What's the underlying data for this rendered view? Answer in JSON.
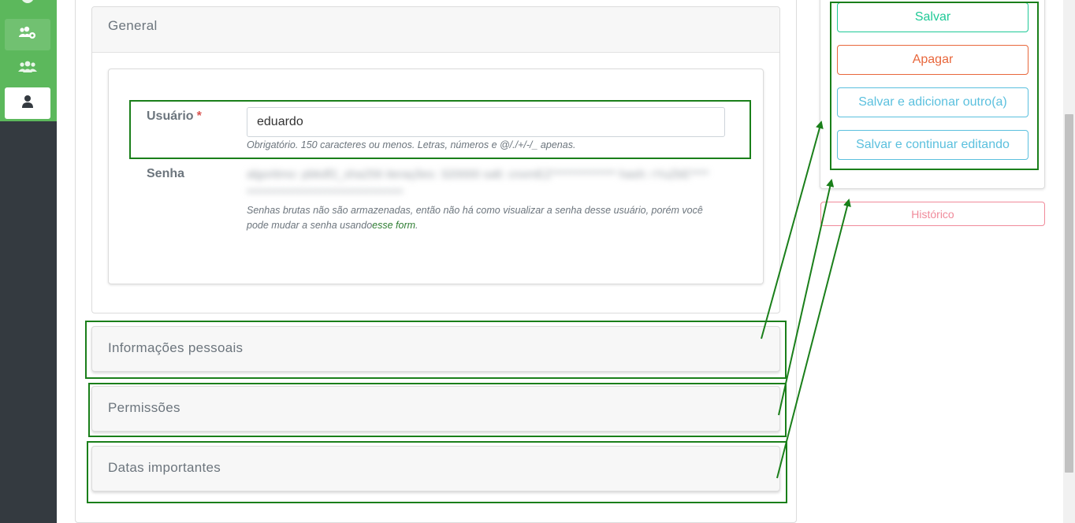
{
  "sidebar": {
    "items": [
      {
        "icon": "compass-icon"
      },
      {
        "icon": "users-cog-icon"
      },
      {
        "icon": "users-icon"
      },
      {
        "icon": "user-icon",
        "active": true
      }
    ]
  },
  "general": {
    "title": "General",
    "username_label": "Usuário",
    "required_mark": "*",
    "username_value": "eduardo",
    "username_help": "Obrigatório. 150 caracteres ou menos. Letras, números e @/./+/-/_ apenas.",
    "password_label": "Senha",
    "password_hash": "algoritmo: pbkdf2_sha256 iterações: 320000 salt: cnxmEZ************** hash: rYuZkE**************************************",
    "password_help_prefix": "Senhas brutas não são armazenadas, então não há como visualizar a senha desse usuário, porém você pode mudar a senha usando",
    "password_help_link": "esse form",
    "password_help_suffix": "."
  },
  "sections": {
    "personal": "Informações pessoais",
    "permissions": "Permissões",
    "dates": "Datas importantes"
  },
  "actions": {
    "save": "Salvar",
    "delete": "Apagar",
    "save_add": "Salvar e adicionar outro(a)",
    "save_continue": "Salvar e continuar editando",
    "history": "Histórico"
  },
  "colors": {
    "sidebar_accent": "#5cb85c",
    "sidebar_dark": "#343a40",
    "annotation": "#1a7f1a",
    "save": "#20c997",
    "delete": "#e8673c",
    "info": "#5bc0de",
    "history": "#f08a9a"
  }
}
